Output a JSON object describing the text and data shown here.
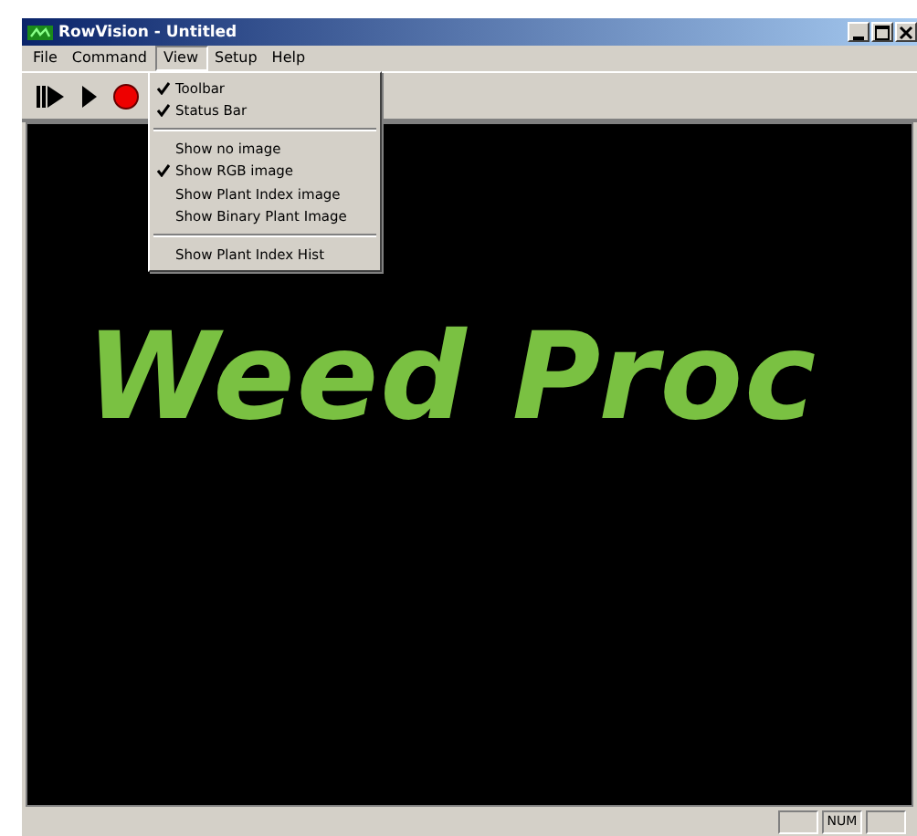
{
  "window": {
    "title": "RowVision - Untitled"
  },
  "menu_bar": [
    {
      "label": "File",
      "selected": false
    },
    {
      "label": "Command",
      "selected": false
    },
    {
      "label": "View",
      "selected": true
    },
    {
      "label": "Setup",
      "selected": false
    },
    {
      "label": "Help",
      "selected": false
    }
  ],
  "view_menu": [
    {
      "kind": "item",
      "label": "Toolbar",
      "checked": true
    },
    {
      "kind": "item",
      "label": "Status Bar",
      "checked": true
    },
    {
      "kind": "separator"
    },
    {
      "kind": "item",
      "label": "Show no image",
      "checked": false
    },
    {
      "kind": "item",
      "label": "Show RGB image",
      "checked": true
    },
    {
      "kind": "item",
      "label": "Show Plant Index image",
      "checked": false
    },
    {
      "kind": "item",
      "label": "Show Binary Plant Image",
      "checked": false
    },
    {
      "kind": "separator"
    },
    {
      "kind": "item",
      "label": "Show Plant Index Hist",
      "checked": false
    }
  ],
  "view": {
    "text": "Weed Proc"
  },
  "status_bar": {
    "indicators": [
      "NUM"
    ]
  }
}
